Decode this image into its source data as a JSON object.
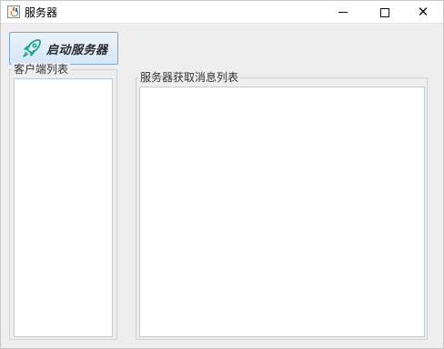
{
  "window": {
    "title": "服务器",
    "controls": {
      "minimize": "minimize",
      "maximize": "maximize",
      "close": "close"
    }
  },
  "toolbar": {
    "start_label": "启动服务器",
    "start_icon": "rocket-icon"
  },
  "clients": {
    "title": "客户端列表",
    "items": []
  },
  "messages": {
    "title": "服务器获取消息列表",
    "items": []
  },
  "colors": {
    "accent_icon": "#1aa689",
    "button_border": "#7aa7d1",
    "list_border": "#b9cfe0"
  }
}
